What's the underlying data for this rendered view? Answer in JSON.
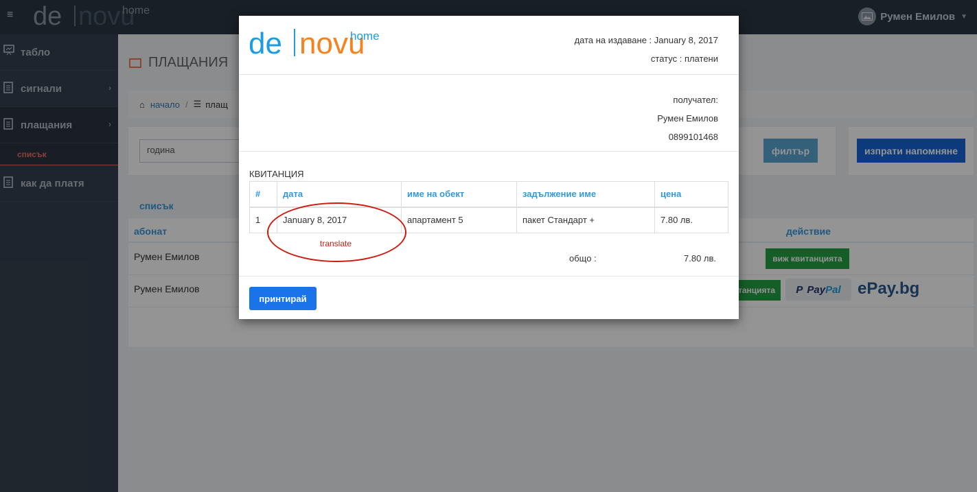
{
  "header": {
    "brand_de": "de",
    "brand_novu": "novu",
    "brand_home": "home",
    "user_name": "Румен Емилов"
  },
  "sidebar": {
    "items": [
      {
        "label": "табло"
      },
      {
        "label": "сигнали"
      },
      {
        "label": "плащания"
      },
      {
        "label": "как да платя"
      }
    ],
    "sub_item": "списък"
  },
  "page": {
    "title": "ПЛАЩАНИЯ",
    "breadcrumb_home": "начало",
    "breadcrumb_current": "плащ"
  },
  "filter": {
    "year_value": "година",
    "filter_button": "филтър",
    "reminder_button": "изпрати напомняне"
  },
  "list": {
    "header": "списък",
    "col_subscriber": "абонат",
    "col_action": "действие",
    "rows": [
      {
        "name": "Румен Емилов",
        "action": "виж квитанцията"
      },
      {
        "name": "Румен Емилов",
        "action": "танцията",
        "paypal_1": "Pay",
        "paypal_2": "Pal",
        "epay": "ePay.bg"
      }
    ]
  },
  "modal": {
    "issue_date_label": "дата на издаване : January 8, 2017",
    "status_label": "статус : платени",
    "recipient_label": "получател:",
    "recipient_name": "Румен Емилов",
    "recipient_phone": "0899101468",
    "receipt_title": "КВИТАНЦИЯ",
    "table": {
      "headers": [
        "#",
        "дата",
        "име на обект",
        "задължение име",
        "цена"
      ],
      "rows": [
        [
          "1",
          "January 8, 2017",
          "апартамент 5",
          "пакет Стандарт +",
          "7.80 лв."
        ]
      ]
    },
    "total_label": "общо :",
    "total_value": "7.80 лв.",
    "print_button": "принтирай"
  },
  "annotation": {
    "text": "translate",
    "color": "#d0190f"
  },
  "colors": {
    "brand_blue": "#1a9ee0",
    "brand_orange": "#f5821f",
    "sidebar_bg": "#364150",
    "header_bg": "#2b3643"
  }
}
